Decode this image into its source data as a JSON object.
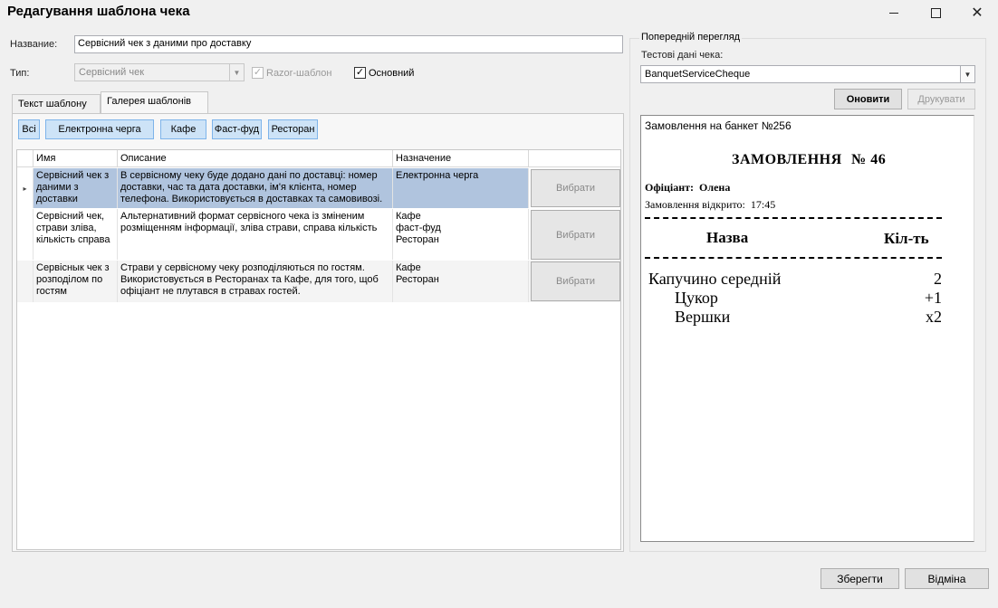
{
  "window": {
    "title": "Редагування шаблона чека"
  },
  "form": {
    "name_label": "Название:",
    "name_value": "Сервісний чек з даними про доставку",
    "type_label": "Тип:",
    "type_value": "Сервісний чек",
    "razor_label": "Razor-шаблон",
    "main_label": "Основний",
    "check_mark": "✓"
  },
  "tabs": [
    {
      "label": "Текст шаблону"
    },
    {
      "label": "Галерея шаблонів"
    }
  ],
  "filters": [
    "Всі",
    "Електронна черга",
    "Кафе",
    "Фаст-фуд",
    "Ресторан"
  ],
  "grid": {
    "headers": {
      "name": "Имя",
      "desc": "Описание",
      "dest": "Назначение"
    },
    "pick_label": "Вибрати",
    "row_marker": "▸",
    "rows": [
      {
        "name": "Сервісний чек з даними з доставки",
        "desc": "В сервісному чеку буде додано дані по доставці: номер доставки, час та дата доставки, ім'я клієнта, номер телефона. Використовується в доставках та самовивозі.",
        "dest": "Електронна черга"
      },
      {
        "name": "Сервісний чек, страви зліва, кількість справа",
        "desc": "Альтернативний формат сервісного чека із зміненим розміщенням інформації, зліва страви, справа кількість",
        "dest": " Кафе\nфаст-фуд\nРесторан"
      },
      {
        "name": "Сервіснык чек з розподілом по гостям",
        "desc": "Страви у сервісному чеку розподіляються по гостям. Використовується в Ресторанах та Кафе, для того, щоб офіціант не плутався в стравах гостей.",
        "dest": "Кафе\nРесторан"
      }
    ]
  },
  "preview": {
    "group_title": "Попередній перегляд",
    "test_data_label": "Тестові дані чека:",
    "test_data_value": "BanquetServiceCheque",
    "refresh_label": "Оновити",
    "print_label": "Друкувати",
    "receipt": {
      "header": "Замовлення на банкет №256",
      "order_title": "ЗАМОВЛЕННЯ",
      "order_number": "№ 46",
      "waiter_label": "Офіціант:",
      "waiter_name": "Олена",
      "opened_label": "Замовлення відкрито:",
      "opened_time": "17:45",
      "col_name": "Назва",
      "col_qty": "Кіл-ть",
      "items": [
        {
          "name": "Капучино середній",
          "qty": "2"
        },
        {
          "name": "Цукор",
          "qty": "+1"
        },
        {
          "name": "Вершки",
          "qty": "x2"
        }
      ]
    }
  },
  "footer": {
    "save_label": "Зберегти",
    "cancel_label": "Відміна"
  }
}
